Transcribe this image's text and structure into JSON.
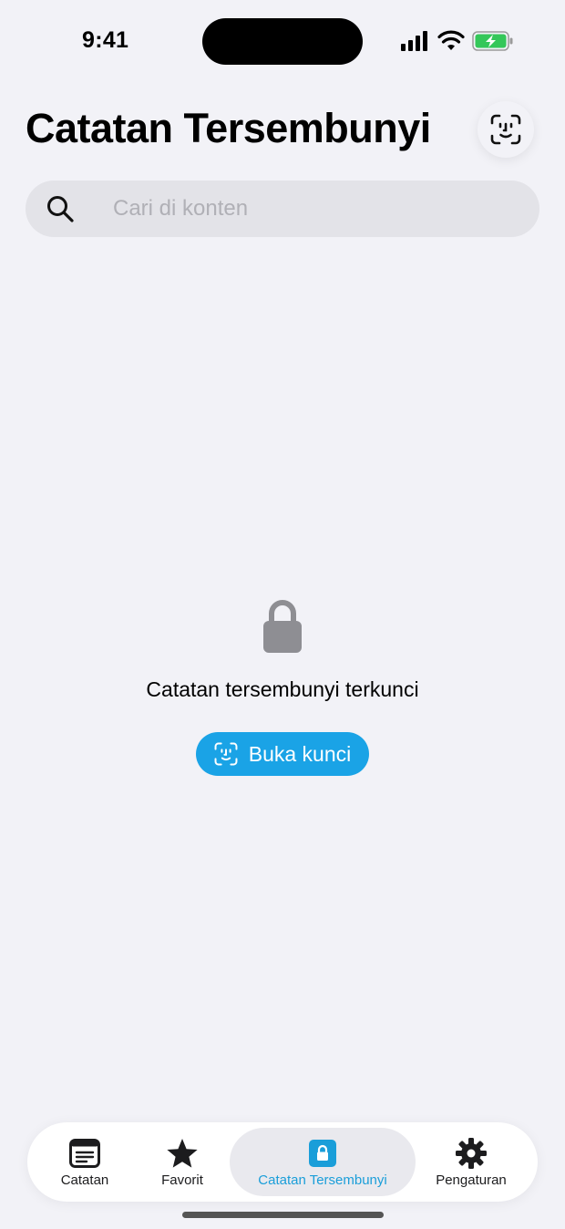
{
  "status_bar": {
    "time": "9:41"
  },
  "header": {
    "title": "Catatan Tersembunyi"
  },
  "search": {
    "placeholder": "Cari di konten"
  },
  "empty_state": {
    "message": "Catatan tersembunyi terkunci",
    "unlock_label": "Buka kunci"
  },
  "tabbar": {
    "tabs": [
      {
        "label": "Catatan",
        "icon": "note-icon",
        "active": false
      },
      {
        "label": "Favorit",
        "icon": "star-icon",
        "active": false
      },
      {
        "label": "Catatan Tersembunyi",
        "icon": "lock-icon",
        "active": true
      },
      {
        "label": "Pengaturan",
        "icon": "gear-icon",
        "active": false
      }
    ]
  },
  "colors": {
    "accent": "#1aa3e6",
    "background": "#f2f2f7",
    "battery_green": "#34c759"
  }
}
